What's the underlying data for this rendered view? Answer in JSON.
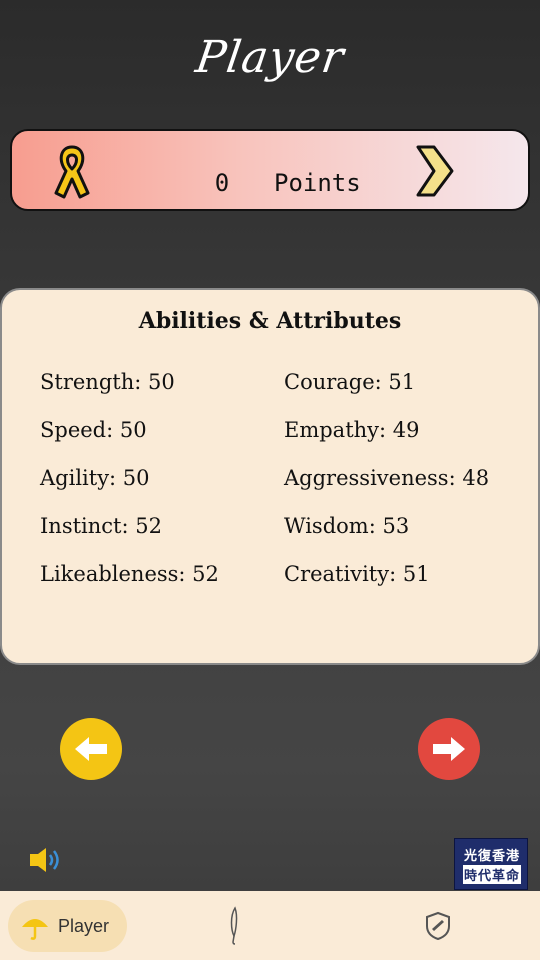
{
  "header": {
    "title": "Player"
  },
  "points": {
    "value": "0",
    "label": "Points"
  },
  "abilities": {
    "title": "Abilities & Attributes",
    "left": [
      {
        "label": "Strength: 50"
      },
      {
        "label": "Speed: 50"
      },
      {
        "label": "Agility: 50"
      },
      {
        "label": "Instinct: 52"
      },
      {
        "label": "Likeableness: 52"
      }
    ],
    "right": [
      {
        "label": "Courage: 51"
      },
      {
        "label": "Empathy: 49"
      },
      {
        "label": "Aggressiveness: 48"
      },
      {
        "label": "Wisdom: 53"
      },
      {
        "label": "Creativity: 51"
      }
    ]
  },
  "seal": {
    "line1": "光復香港",
    "line2": "時代革命"
  },
  "bottom_nav": {
    "tabs": [
      {
        "label": "Player",
        "icon": "umbrella-icon",
        "active": true
      },
      {
        "label": "",
        "icon": "feather-icon",
        "active": false
      },
      {
        "label": "",
        "icon": "shield-icon",
        "active": false
      }
    ]
  },
  "colors": {
    "accent_yellow": "#f4c514",
    "accent_red": "#e2483f",
    "card_bg": "#faebd7"
  },
  "icons": {
    "points_left": "ribbon-icon",
    "points_right": "chevron-right-icon",
    "back": "arrow-left-icon",
    "next": "arrow-right-icon",
    "sound": "speaker-icon"
  }
}
